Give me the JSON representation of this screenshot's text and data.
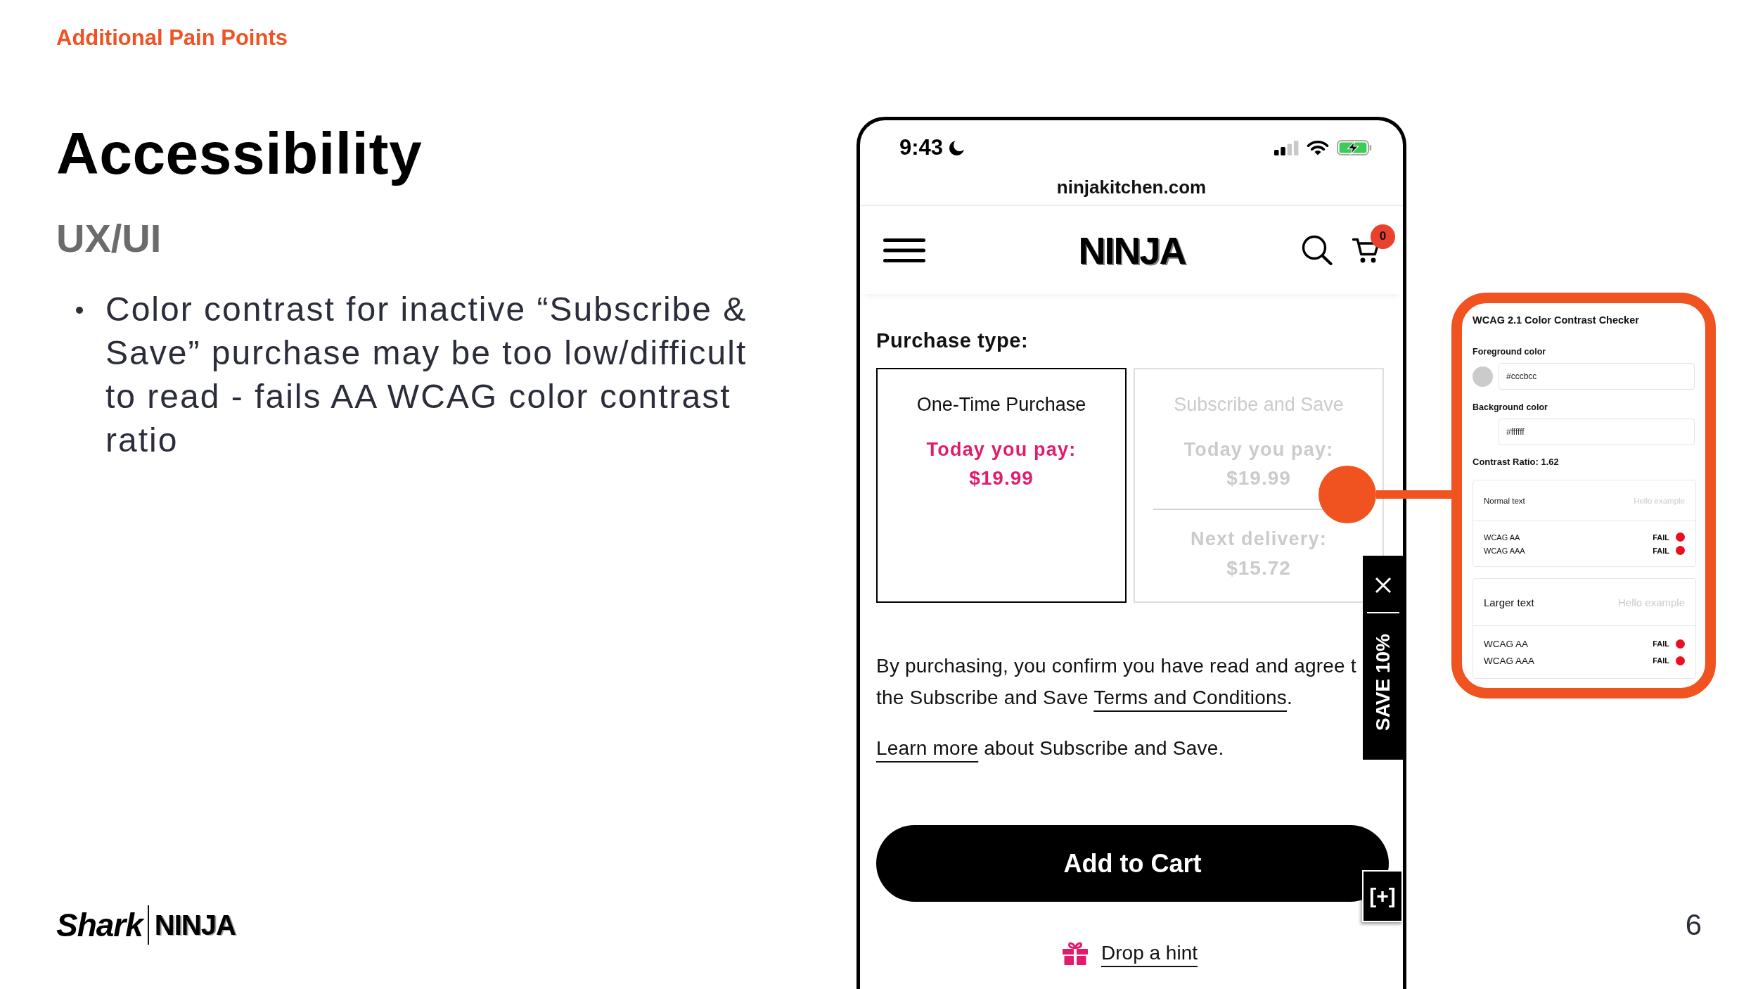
{
  "slide": {
    "section": "Additional Pain Points",
    "title": "Accessibility",
    "subtitle": "UX/UI",
    "bullets": [
      "Color contrast for inactive “Subscribe & Save” purchase may be too low/difficult to read - fails AA WCAG color contrast ratio"
    ],
    "logo": {
      "left": "Shark",
      "right": "NINJA"
    },
    "page_number": "6"
  },
  "phone": {
    "status_bar": {
      "time": "9:43"
    },
    "url": "ninjakitchen.com",
    "header": {
      "logo": "NINJA",
      "cart_count": "0"
    },
    "purchase": {
      "label": "Purchase type:",
      "options": [
        {
          "title": "One-Time Purchase",
          "pay_label": "Today you pay:",
          "price": "$19.99",
          "selected": true
        },
        {
          "title": "Subscribe and Save",
          "pay_label": "Today you pay:",
          "price": "$19.99",
          "next_label": "Next delivery:",
          "next_price": "$15.72",
          "selected": false
        }
      ]
    },
    "terms": {
      "lines": [
        "By purchasing, you confirm you have read and agree t",
        "the Subscribe and Save"
      ],
      "link": "Terms and Conditions",
      "end": "."
    },
    "learn_more": {
      "link": "Learn more",
      "text": "about Subscribe and Save."
    },
    "add_to_cart": "Add to Cart",
    "save_tab": "SAVE 10%",
    "expand_tab": "[+]",
    "hint": "Drop a hint"
  },
  "checker": {
    "title": "WCAG 2.1 Color Contrast Checker",
    "fields": [
      {
        "label": "Foreground color",
        "value": "#cccbcc",
        "color": "#cccbcc"
      },
      {
        "label": "Background color",
        "value": "#ffffff"
      }
    ],
    "ratio": "Contrast Ratio: 1.62",
    "results": [
      {
        "kind": "normal",
        "label": "Normal text",
        "sample": "Hello example",
        "rows": [
          {
            "standard": "WCAG AA",
            "result": "FAIL",
            "color": "#ee0d1e"
          },
          {
            "standard": "WCAG AAA",
            "result": "FAIL",
            "color": "#ee0d1e"
          }
        ]
      },
      {
        "kind": "large",
        "label": "Larger text",
        "sample": "Hello example",
        "rows": [
          {
            "standard": "WCAG AA",
            "result": "FAIL",
            "color": "#ee0d1e"
          },
          {
            "standard": "WCAG AAA",
            "result": "FAIL",
            "color": "#ee0d1e"
          }
        ]
      }
    ]
  }
}
